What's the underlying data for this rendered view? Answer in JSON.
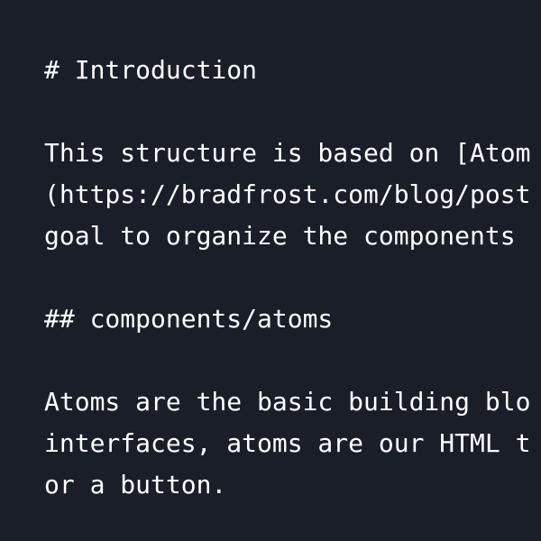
{
  "document": {
    "lines": [
      "# Introduction",
      "This structure is based on [Atom",
      "(https://bradfrost.com/blog/post",
      "goal to organize the components",
      "## components/atoms",
      "Atoms are the basic building blo",
      "interfaces, atoms are our HTML t",
      "or a button."
    ]
  },
  "colors": {
    "background": "#1a1e29",
    "text": "#ffffff"
  }
}
